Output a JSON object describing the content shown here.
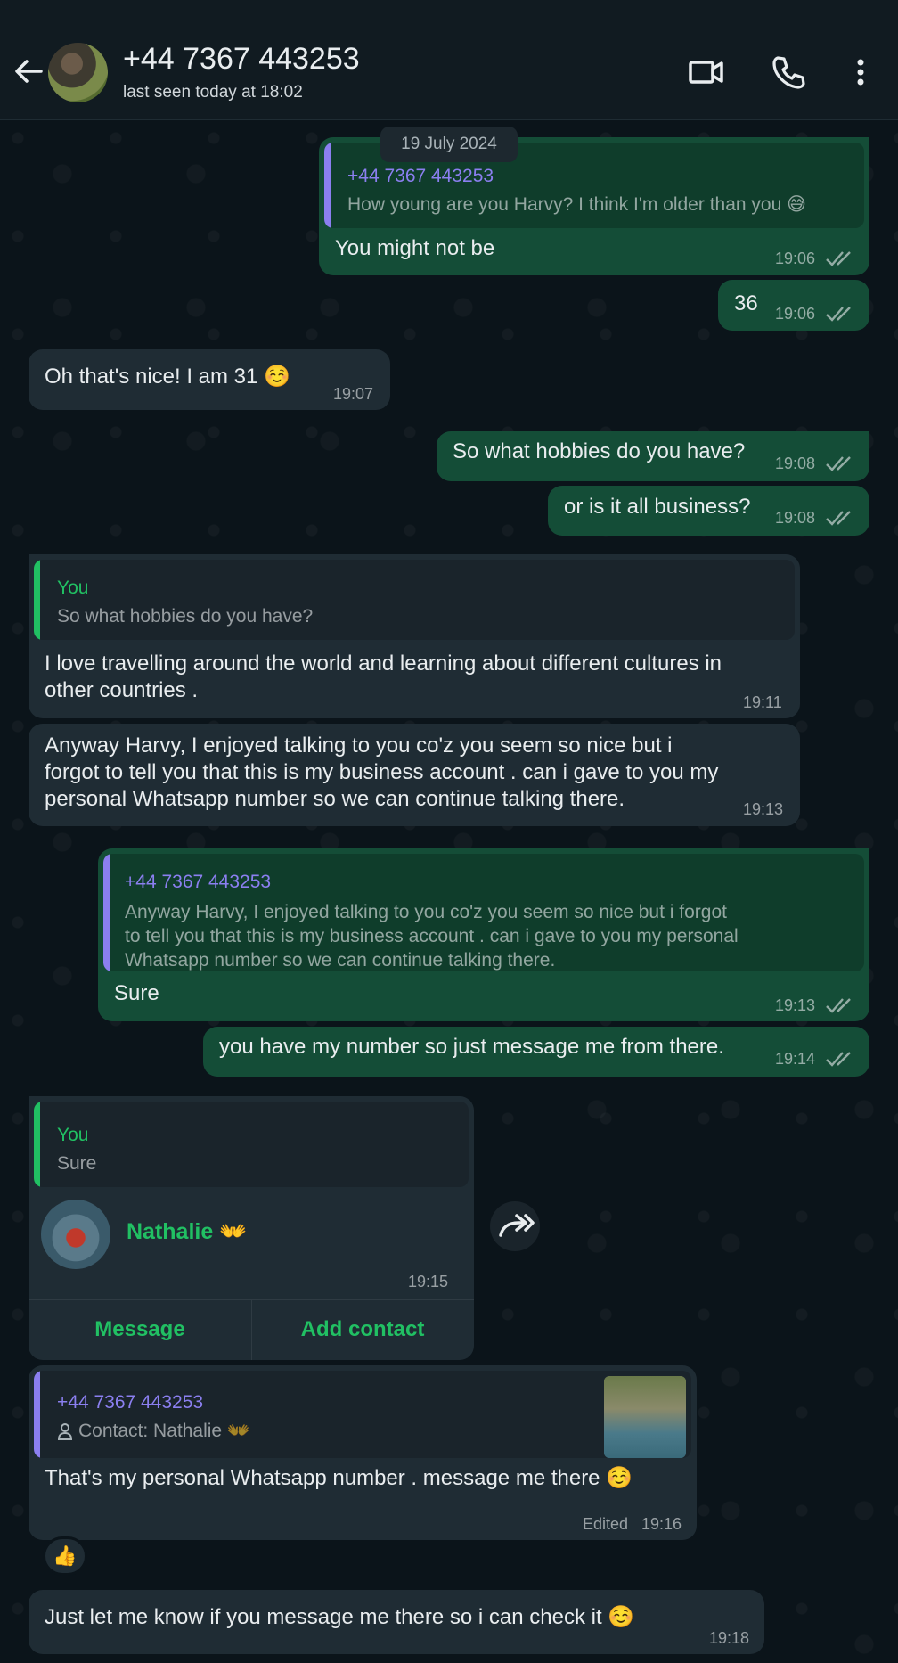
{
  "header": {
    "title": "+44 7367 443253",
    "subtitle": "last seen today at 18:02"
  },
  "date_chip": "19 July 2024",
  "messages": [
    {
      "type": "out",
      "quote_name": "+44 7367 443253",
      "quote_text": "How young are you Harvy? I think I'm older than you 😅",
      "text": "You might not be",
      "time": "19:06"
    },
    {
      "type": "out",
      "text": "36",
      "time": "19:06"
    },
    {
      "type": "in",
      "text": "Oh that's nice! I am 31 ☺️",
      "time": "19:07"
    },
    {
      "type": "out",
      "text": "So what hobbies do you have?",
      "time": "19:08"
    },
    {
      "type": "out",
      "text": "or is it all business?",
      "time": "19:08"
    },
    {
      "type": "in",
      "quote_name": "You",
      "quote_text": "So what hobbies do you have?",
      "text_line1": "I love travelling around the world and learning about different cultures in",
      "text_line2": "other countries .",
      "time": "19:11"
    },
    {
      "type": "in",
      "text_line1": "Anyway Harvy, I enjoyed talking to you co'z you seem so nice but i",
      "text_line2": "forgot to tell you that this is my business account . can i gave to you my",
      "text_line3": "personal Whatsapp number so we can continue talking there.",
      "time": "19:13"
    },
    {
      "type": "out",
      "quote_name": "+44 7367 443253",
      "quote_line1": "Anyway Harvy, I enjoyed talking to you co'z you seem so nice but i forgot",
      "quote_line2": "to tell you that this is my business account . can i gave to you my personal",
      "quote_line3": "Whatsapp number so we can continue talking there.",
      "text": "Sure",
      "time": "19:13"
    },
    {
      "type": "out",
      "text": "you have my number so just message me from there.",
      "time": "19:14"
    },
    {
      "type": "in",
      "quote_name": "You",
      "quote_text": "Sure",
      "contact_name": "Nathalie 👐",
      "time": "19:15",
      "btn_message": "Message",
      "btn_add": "Add contact"
    },
    {
      "type": "in",
      "quote_name": "+44 7367 443253",
      "quote_text": "Contact: Nathalie 👐",
      "text": "That's my personal Whatsapp number . message me there ☺️",
      "edited": "Edited",
      "time": "19:16",
      "reaction": "👍"
    },
    {
      "type": "in",
      "text": "Just let me know if you message me there so i can check it ☺️",
      "time": "19:18"
    }
  ],
  "colors": {
    "out_bubble": "#144d37",
    "in_bubble": "#1f2c34",
    "accent_green": "#21c063",
    "quote_purple": "#8b7ff0",
    "header_bg": "#111b21"
  },
  "icons": [
    "back-arrow-icon",
    "video-call-icon",
    "phone-icon",
    "more-vert-icon",
    "double-check-icon",
    "forward-icon",
    "person-icon"
  ]
}
